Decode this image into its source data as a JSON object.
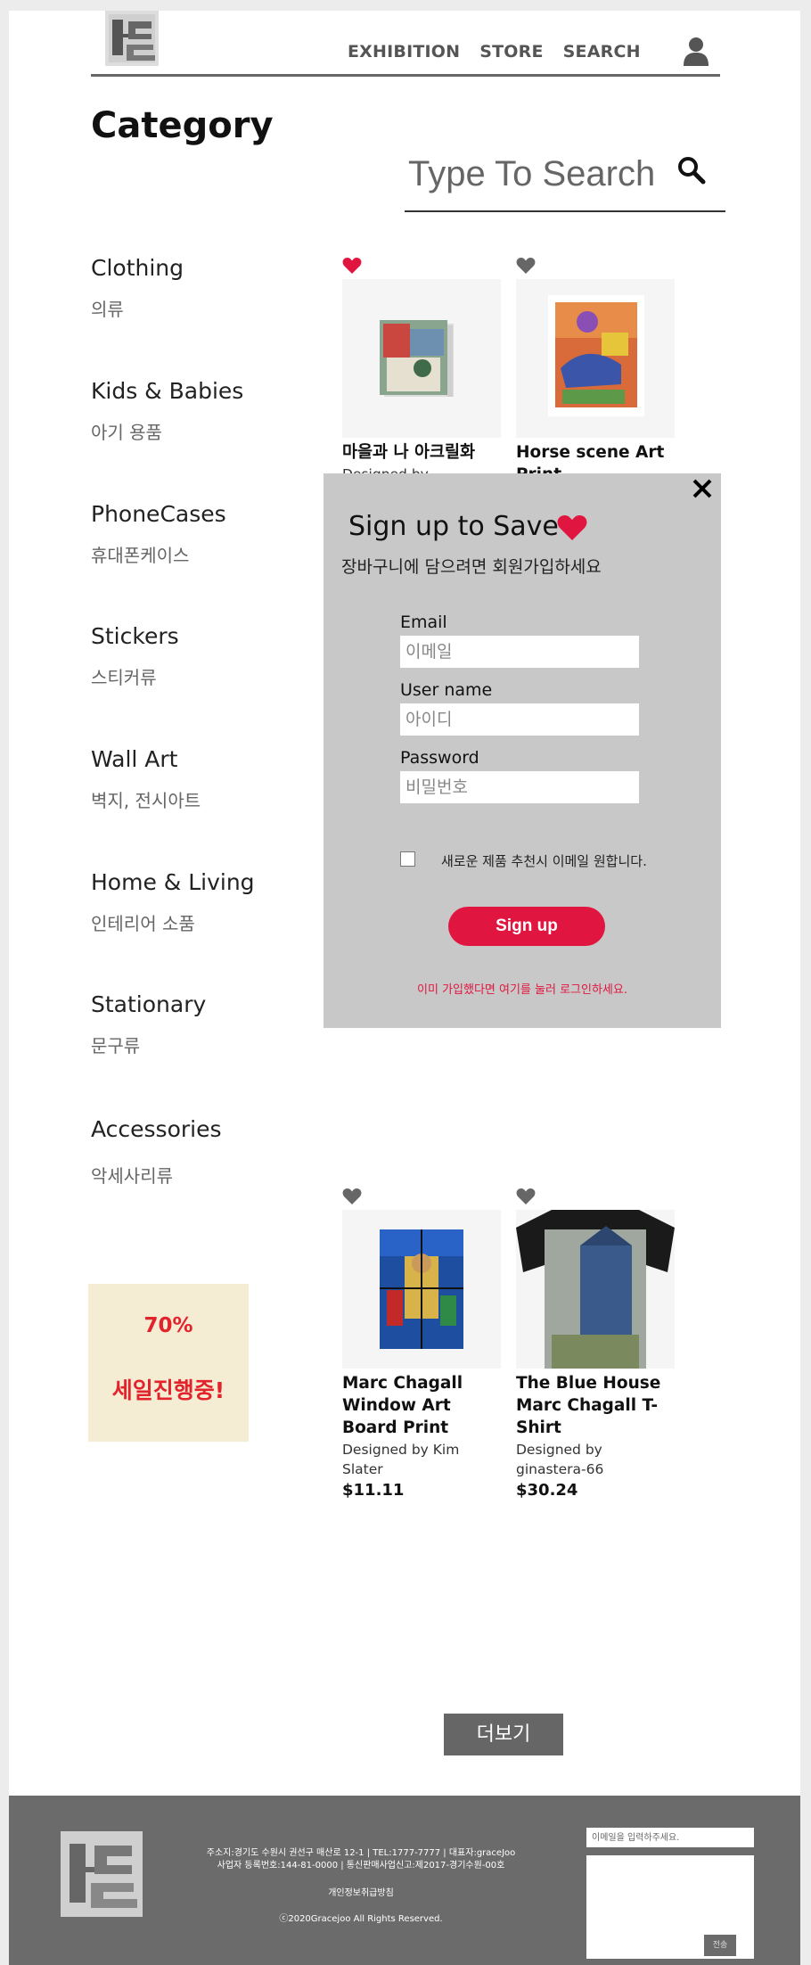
{
  "header": {
    "nav": [
      "EXHIBITION",
      "STORE",
      "SEARCH"
    ],
    "title": "Category",
    "search_placeholder": "Type To Search"
  },
  "sidebar": {
    "items": [
      {
        "en": "Clothing",
        "ko": "의류"
      },
      {
        "en": "Kids & Babies",
        "ko": "아기 용품"
      },
      {
        "en": "PhoneCases",
        "ko": "휴대폰케이스"
      },
      {
        "en": "Stickers",
        "ko": "스티커류"
      },
      {
        "en": "Wall Art",
        "ko": "벽지, 전시아트"
      },
      {
        "en": "Home & Living",
        "ko": "인테리어 소품"
      },
      {
        "en": "Stationary",
        "ko": "문구류"
      },
      {
        "en": "Accessories",
        "ko": "악세사리류"
      }
    ]
  },
  "sale": {
    "percent": "70%",
    "text": "세일진행중!"
  },
  "products": [
    {
      "title": "마을과 나 아크릴화",
      "designer": "Designed by",
      "price": "",
      "liked": true
    },
    {
      "title": "Horse scene Art Print",
      "designer": "",
      "price": "",
      "liked": false
    },
    {
      "title": "Marc Chagall Window Art Board Print",
      "designer": "Designed by Kim Slater",
      "price": "$11.11",
      "liked": false
    },
    {
      "title": "The Blue House Marc Chagall T-Shirt",
      "designer": "Designed by ginastera-66",
      "price": "$30.24",
      "liked": false
    }
  ],
  "modal": {
    "title": "Sign up to Save",
    "subtitle": "장바구니에 담으려면 회원가입하세요",
    "email_label": "Email",
    "email_placeholder": "이메일",
    "username_label": "User name",
    "username_placeholder": "아이디",
    "password_label": "Password",
    "password_placeholder": "비밀번호",
    "checkbox_label": "새로운 제품 추천시 이메일 원합니다.",
    "signup_label": "Sign up",
    "login_link": "이미 가입했다면 여기를 눌러 로그인하세요."
  },
  "more_label": "더보기",
  "footer": {
    "address_line1": "주소지:경기도 수원시 권선구 매산로 12-1 | TEL:1777-7777 | 대표자:graceJoo",
    "address_line2": "사업자 등록번호:144-81-0000 | 통신판매사업신고:제2017-경기수원-00호",
    "privacy": "개인정보취급방침",
    "copyright": "ⓒ2020Gracejoo All Rights Reserved.",
    "email_placeholder": "이메일을 입력하주세요.",
    "send_label": "전송"
  },
  "colors": {
    "accent": "#e11640",
    "sale": "#e3232b",
    "footer": "#6b6b6b",
    "modal": "#c8c8c8"
  }
}
